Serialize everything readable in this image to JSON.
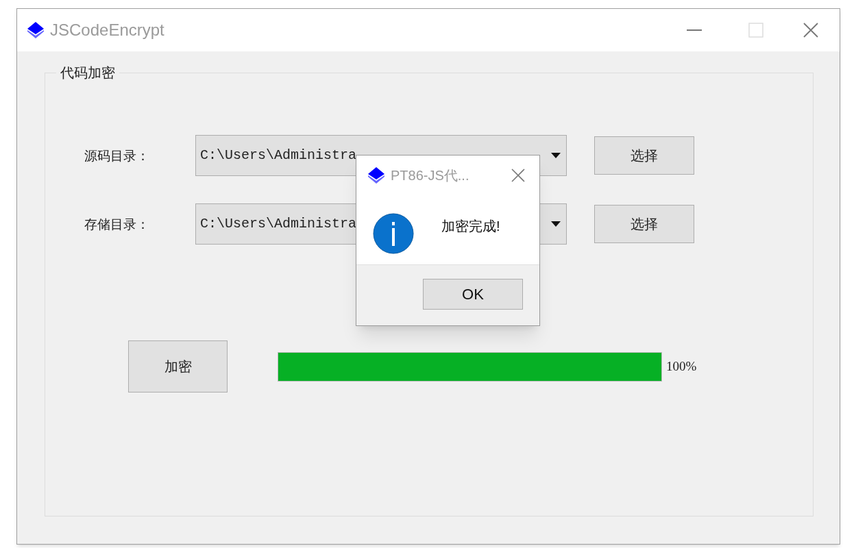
{
  "window": {
    "title": "JSCodeEncrypt"
  },
  "group": {
    "title": "代码加密"
  },
  "rows": [
    {
      "label": "源码目录：",
      "value": "C:\\Users\\Administra",
      "button": "选择"
    },
    {
      "label": "存储目录：",
      "value": "C:\\Users\\Administra",
      "button": "选择"
    }
  ],
  "encrypt_button": "加密",
  "progress": {
    "level": 1,
    "reading": "100%"
  },
  "dialog": {
    "title": "PT86-JS代...",
    "message": "加密完成!",
    "button": "OK"
  }
}
